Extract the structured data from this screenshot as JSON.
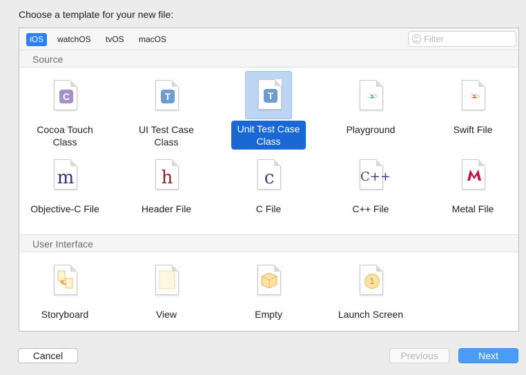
{
  "dialog": {
    "title": "Choose a template for your new file:"
  },
  "platform_tabs": [
    {
      "label": "iOS",
      "active": true
    },
    {
      "label": "watchOS",
      "active": false
    },
    {
      "label": "tvOS",
      "active": false
    },
    {
      "label": "macOS",
      "active": false
    }
  ],
  "filter": {
    "placeholder": "Filter"
  },
  "sections": [
    {
      "label": "Source"
    },
    {
      "label": "User Interface"
    }
  ],
  "source_items": [
    {
      "label": "Cocoa Touch\nClass",
      "glyph": "C",
      "icon": "cocoa-touch-class-icon",
      "color": "#a48fc8"
    },
    {
      "label": "UI Test Case\nClass",
      "glyph": "T",
      "icon": "ui-test-case-class-icon",
      "color": "#6f9ccc"
    },
    {
      "label": "Unit Test Case\nClass",
      "glyph": "T",
      "icon": "unit-test-case-class-icon",
      "color": "#6f9ccc",
      "selected": true
    },
    {
      "label": "Playground",
      "glyph": "",
      "icon": "playground-icon",
      "color": "#3e9df0"
    },
    {
      "label": "Swift File",
      "glyph": "",
      "icon": "swift-file-icon",
      "color": "#f05138"
    },
    {
      "label": "Objective-C File",
      "glyph": "m",
      "icon": "objective-c-file-icon",
      "color": "#3a2a7a"
    },
    {
      "label": "Header File",
      "glyph": "h",
      "icon": "header-file-icon",
      "color": "#8a1f2a"
    },
    {
      "label": "C File",
      "glyph": "c",
      "icon": "c-file-icon",
      "color": "#4a3a8a"
    },
    {
      "label": "C++ File",
      "glyph": "C++",
      "icon": "cpp-file-icon",
      "color": "#3a3a8a"
    },
    {
      "label": "Metal File",
      "glyph": "",
      "icon": "metal-file-icon",
      "color": "#c8124a"
    }
  ],
  "ui_items": [
    {
      "label": "Storyboard",
      "icon": "storyboard-icon"
    },
    {
      "label": "View",
      "icon": "view-icon"
    },
    {
      "label": "Empty",
      "icon": "empty-icon"
    },
    {
      "label": "Launch Screen",
      "glyph": "1",
      "icon": "launch-screen-icon"
    }
  ],
  "buttons": {
    "cancel": "Cancel",
    "previous": "Previous",
    "next": "Next"
  }
}
